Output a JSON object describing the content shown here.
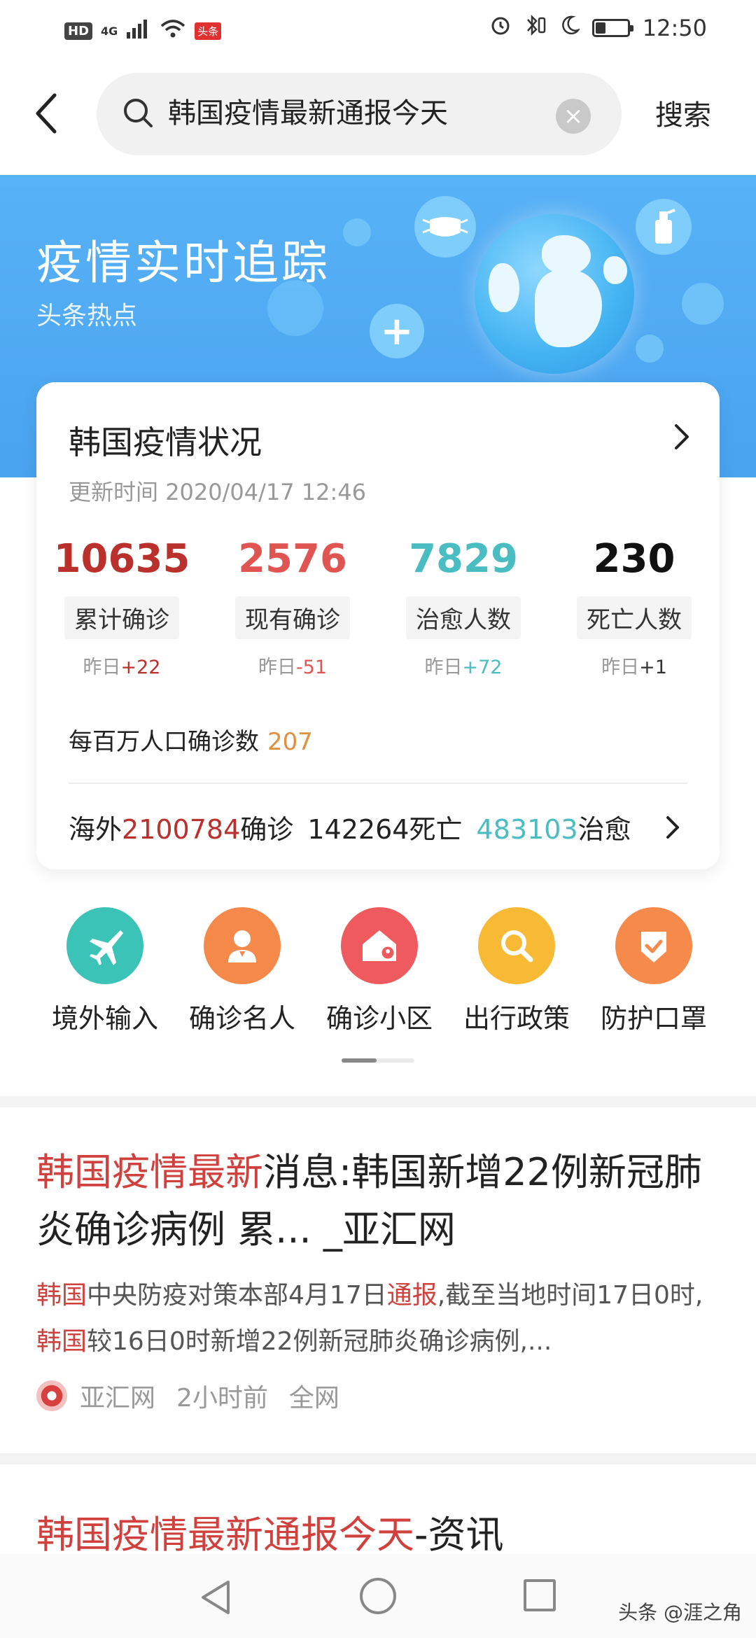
{
  "status_bar": {
    "hd": "HD",
    "network": "4G",
    "app_badge": "头条",
    "time": "12:50"
  },
  "search": {
    "query": "韩国疫情最新通报今天",
    "button_label": "搜索"
  },
  "banner": {
    "title": "疫情实时追踪",
    "subtitle": "头条热点"
  },
  "summary": {
    "title": "韩国疫情状况",
    "updated_label": "更新时间",
    "updated_time": "2020/04/17 12:46",
    "stats": [
      {
        "value": "10635",
        "label": "累计确诊",
        "yest_prefix": "昨日",
        "yest_delta": "+22",
        "color": "#b9302d",
        "delta_color": "#b9302d"
      },
      {
        "value": "2576",
        "label": "现有确诊",
        "yest_prefix": "昨日",
        "yest_delta": "-51",
        "color": "#e05552",
        "delta_color": "#e05552"
      },
      {
        "value": "7829",
        "label": "治愈人数",
        "yest_prefix": "昨日",
        "yest_delta": "+72",
        "color": "#4abdc2",
        "delta_color": "#4abdc2"
      },
      {
        "value": "230",
        "label": "死亡人数",
        "yest_prefix": "昨日",
        "yest_delta": "+1",
        "color": "#111111",
        "delta_color": "#333333"
      }
    ],
    "per_million_label": "每百万人口确诊数",
    "per_million_value": "207",
    "overseas": {
      "prefix": "海外",
      "confirmed": "2100784",
      "confirmed_label": "确诊",
      "deaths": "142264",
      "deaths_label": "死亡",
      "recovered": "483103",
      "recovered_label": "治愈"
    }
  },
  "quick_links": [
    {
      "label": "境外输入",
      "icon": "airplane-icon",
      "color": "#3cc3b8"
    },
    {
      "label": "确诊名人",
      "icon": "person-icon",
      "color": "#f5894a"
    },
    {
      "label": "确诊小区",
      "icon": "house-location-icon",
      "color": "#ee5a5d"
    },
    {
      "label": "出行政策",
      "icon": "search-icon",
      "color": "#f8b935"
    },
    {
      "label": "防护口罩",
      "icon": "shield-check-icon",
      "color": "#f58a4b"
    }
  ],
  "articles": [
    {
      "title_hl": "韩国疫情最新",
      "title_rest": "消息:韩国新增22例新冠肺炎确诊病例 累... _亚汇网",
      "body": [
        {
          "text": "韩国",
          "hl": true
        },
        {
          "text": "中央防疫对策本部4月17日",
          "hl": false
        },
        {
          "text": "通报",
          "hl": true
        },
        {
          "text": ",截至当地时间17日0时,",
          "hl": false
        },
        {
          "text": "韩国",
          "hl": true
        },
        {
          "text": "较16日0时新增22例新冠肺炎确诊病例,...",
          "hl": false
        }
      ],
      "source": "亚汇网",
      "time": "2小时前",
      "scope": "全网"
    },
    {
      "title_hl": "韩国疫情最新通报今天",
      "title_rest": "-资讯"
    }
  ],
  "watermark": "头条 @涯之角"
}
